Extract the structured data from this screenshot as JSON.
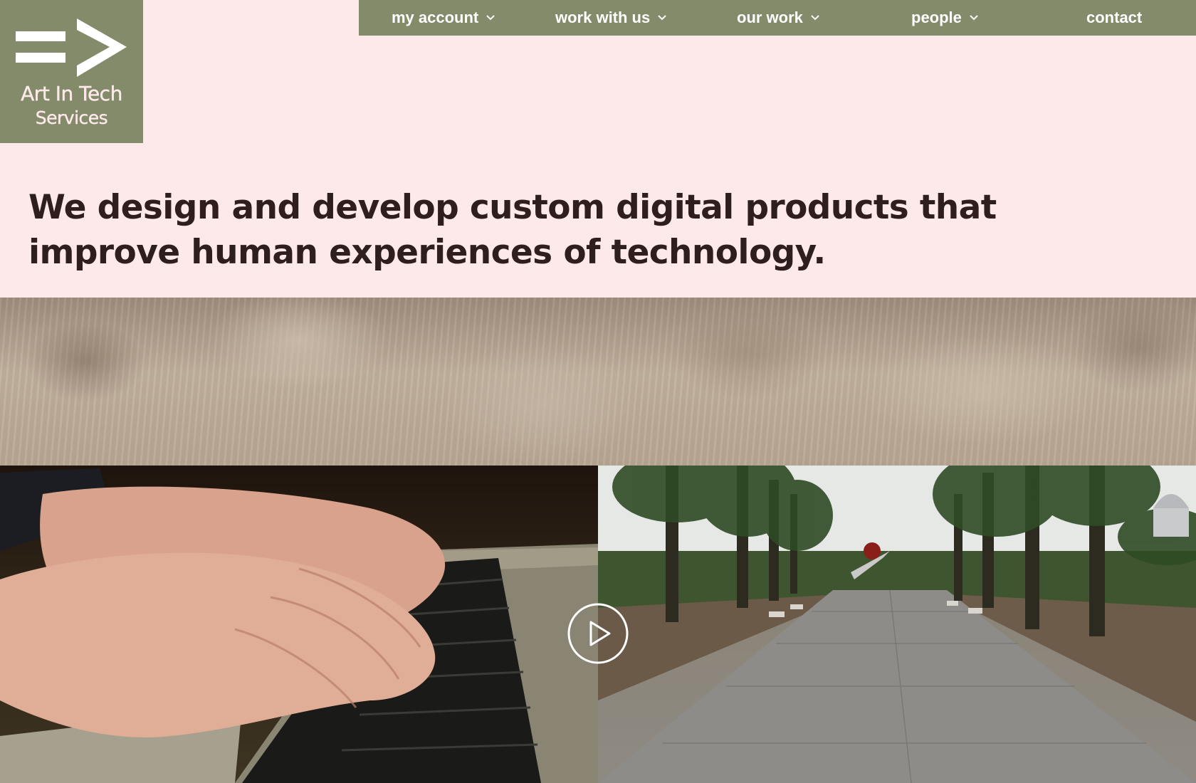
{
  "brand": {
    "logo_line1": "Art In Tech",
    "logo_line2": "Services",
    "logo_color": "#838b6a",
    "logo_glyph": "=>"
  },
  "nav": {
    "items": [
      {
        "label": "my account",
        "has_dropdown": true
      },
      {
        "label": "work with us",
        "has_dropdown": true
      },
      {
        "label": "our work",
        "has_dropdown": true
      },
      {
        "label": "people",
        "has_dropdown": true
      },
      {
        "label": "contact",
        "has_dropdown": false
      }
    ],
    "background": "#838b6a",
    "text_color": "#ffffff"
  },
  "hero": {
    "headline": "We design and develop custom digital products that improve human experiences of technology."
  },
  "video": {
    "play_icon": "play-icon"
  },
  "colors": {
    "page_background": "#fde9e9",
    "headline_color": "#2e1f1c"
  }
}
